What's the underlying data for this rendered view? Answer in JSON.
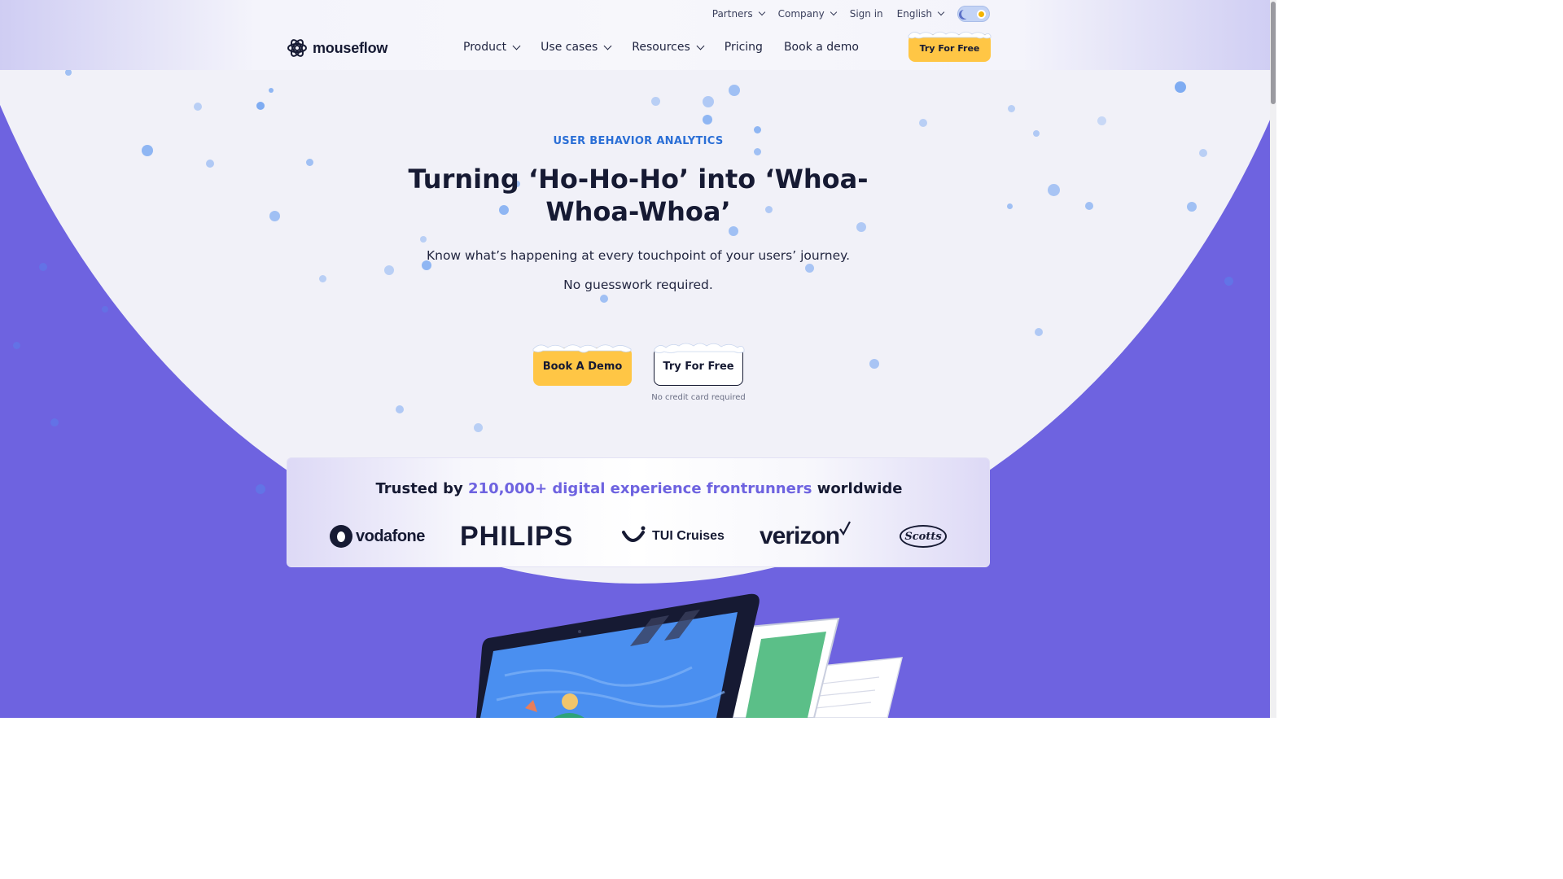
{
  "utility_nav": {
    "partners": "Partners",
    "company": "Company",
    "sign_in": "Sign in",
    "language": "English"
  },
  "brand": {
    "name": "mouseflow"
  },
  "main_nav": {
    "product": "Product",
    "use_cases": "Use cases",
    "resources": "Resources",
    "pricing": "Pricing",
    "book_demo": "Book a demo",
    "cta": "Try For Free"
  },
  "hero": {
    "eyebrow": "USER BEHAVIOR ANALYTICS",
    "title": "Turning ‘Ho-Ho-Ho’ into ‘Whoa-Whoa-Whoa’",
    "subtitle": "Know what’s happening at every touchpoint of your users’ journey.",
    "subtitle2": "No guesswork required.",
    "primary_button": "Book A Demo",
    "secondary_button": "Try For Free",
    "note": "No credit card required"
  },
  "trusted": {
    "prefix": "Trusted by ",
    "highlight": "210,000+ digital experience frontrunners",
    "suffix": " worldwide",
    "logos": [
      "vodafone",
      "PHILIPS",
      "TUI Cruises",
      "verizon",
      "Scotts"
    ]
  },
  "colors": {
    "accent_purple": "#6e63e0",
    "cta_yellow": "#ffc645",
    "eyebrow_blue": "#2b6fd6",
    "text_dark": "#161a33"
  }
}
